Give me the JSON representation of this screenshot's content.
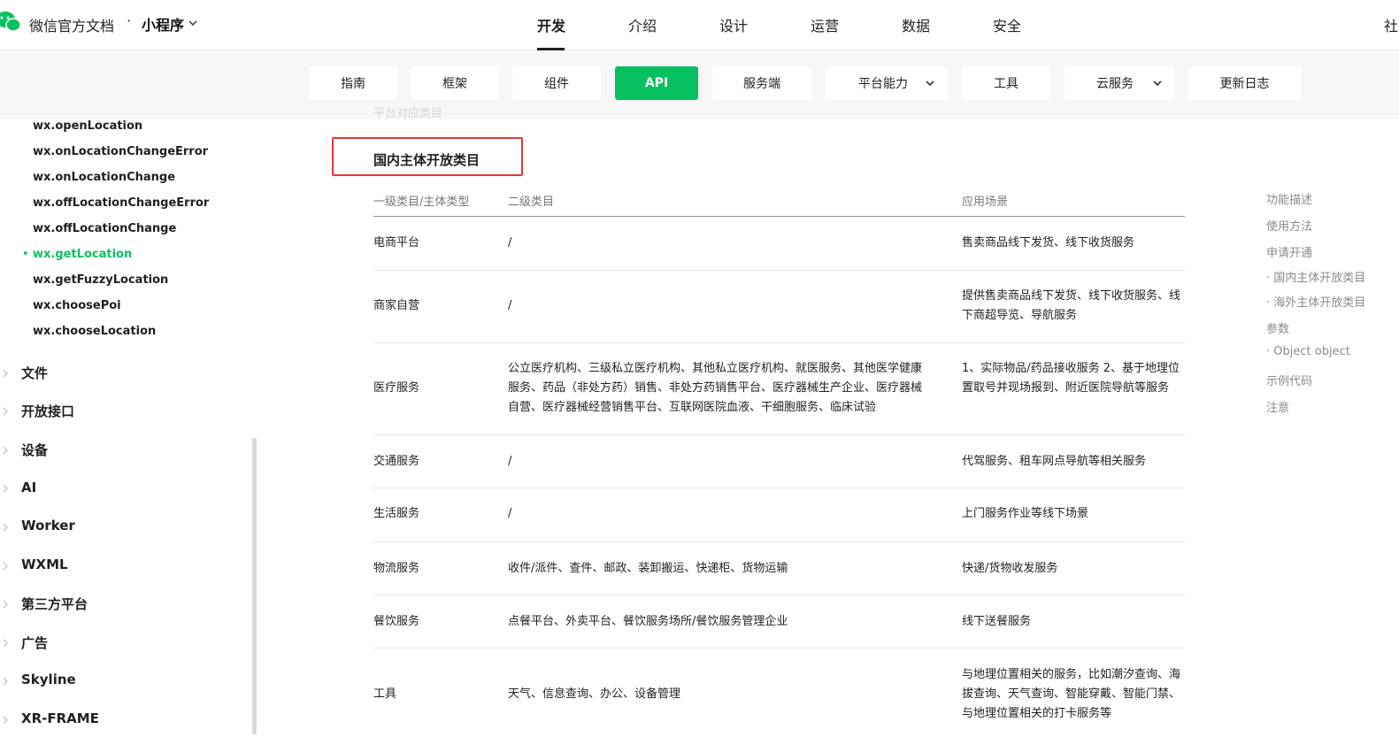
{
  "header": {
    "brand": "微信官方文档",
    "dot": "·",
    "product": "小程序",
    "nav": [
      {
        "label": "开发",
        "active": true
      },
      {
        "label": "介绍",
        "active": false
      },
      {
        "label": "设计",
        "active": false
      },
      {
        "label": "运营",
        "active": false
      },
      {
        "label": "数据",
        "active": false
      },
      {
        "label": "安全",
        "active": false
      }
    ],
    "edge_text": "社"
  },
  "subnav": [
    {
      "label": "指南",
      "active": false
    },
    {
      "label": "框架",
      "active": false
    },
    {
      "label": "组件",
      "active": false
    },
    {
      "label": "API",
      "active": true
    },
    {
      "label": "服务端",
      "active": false
    },
    {
      "label": "平台能力",
      "active": false,
      "dropdown": true
    },
    {
      "label": "工具",
      "active": false
    },
    {
      "label": "云服务",
      "active": false,
      "dropdown": true
    },
    {
      "label": "更新日志",
      "active": false
    }
  ],
  "sidebar": {
    "sub_items": [
      {
        "label": "wx.openLocation",
        "active": false
      },
      {
        "label": "wx.onLocationChangeError",
        "active": false
      },
      {
        "label": "wx.onLocationChange",
        "active": false
      },
      {
        "label": "wx.offLocationChangeError",
        "active": false
      },
      {
        "label": "wx.offLocationChange",
        "active": false
      },
      {
        "label": "wx.getLocation",
        "active": true
      },
      {
        "label": "wx.getFuzzyLocation",
        "active": false
      },
      {
        "label": "wx.choosePoi",
        "active": false
      },
      {
        "label": "wx.chooseLocation",
        "active": false
      }
    ],
    "bullet": "•",
    "top_items": [
      "文件",
      "开放接口",
      "设备",
      "AI",
      "Worker",
      "WXML",
      "第三方平台",
      "广告",
      "Skyline",
      "XR-FRAME"
    ]
  },
  "main": {
    "faded_text": "平台对应类目",
    "section_title": "国内主体开放类目",
    "table": {
      "headers": [
        "一级类目/主体类型",
        "二级类目",
        "应用场景"
      ],
      "rows": [
        {
          "c1": "电商平台",
          "c2": "/",
          "c3": "售卖商品线下发货、线下收货服务"
        },
        {
          "c1": "商家自营",
          "c2": "/",
          "c3": "提供售卖商品线下发货、线下收货服务、线下商超导览、导航服务"
        },
        {
          "c1": "医疗服务",
          "c2": "公立医疗机构、三级私立医疗机构、其他私立医疗机构、就医服务、其他医学健康服务、药品（非处方药）销售、非处方药销售平台、医疗器械生产企业、医疗器械自营、医疗器械经营销售平台、互联网医院血液、干细胞服务、临床试验",
          "c3": "1、实际物品/药品接收服务 2、基于地理位置取号并现场报到、附近医院导航等服务"
        },
        {
          "c1": "交通服务",
          "c2": "/",
          "c3": "代驾服务、租车网点导航等相关服务"
        },
        {
          "c1": "生活服务",
          "c2": "/",
          "c3": "上门服务作业等线下场景"
        },
        {
          "c1": "物流服务",
          "c2": "收件/派件、查件、邮政、装卸搬运、快递柜、货物运输",
          "c3": "快递/货物收发服务"
        },
        {
          "c1": "餐饮服务",
          "c2": "点餐平台、外卖平台、餐饮服务场所/餐饮服务管理企业",
          "c3": "线下送餐服务"
        },
        {
          "c1": "工具",
          "c2": "天气、信息查询、办公、设备管理",
          "c3": "与地理位置相关的服务，比如潮汐查询、海拔查询、天气查询、智能穿戴、智能门禁、与地理位置相关的打卡服务等"
        }
      ]
    }
  },
  "toc": [
    "功能描述",
    "使用方法",
    "申请开通",
    "· 国内主体开放类目",
    "· 海外主体开放类目",
    "参数",
    "· Object object",
    "示例代码",
    "注意"
  ],
  "colors": {
    "accent": "#07c160",
    "highlight_border": "#e03a3a"
  }
}
